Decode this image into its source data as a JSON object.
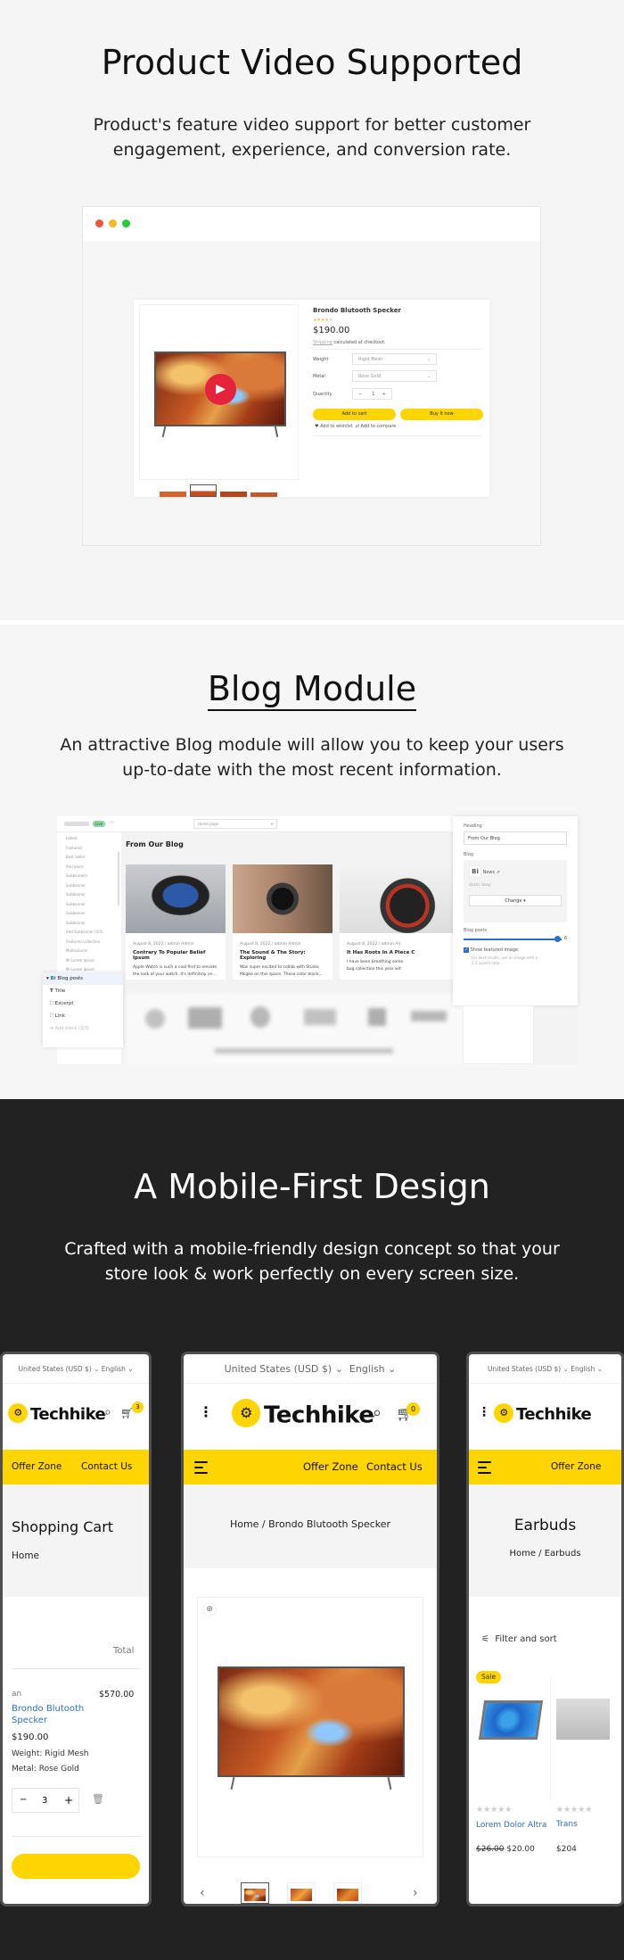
{
  "sections": {
    "video": {
      "title": "Product Video Supported",
      "subtitle_lines": [
        "Product's feature video support for better customer",
        "engagement, experience, and conversion rate."
      ],
      "product": {
        "name": "Brondo Blutooth Specker",
        "rating": 4,
        "price": "$190.00",
        "shipping_link": "Shipping",
        "shipping_text": "calculated at checkout.",
        "weight_label": "Weight",
        "weight_value": "Rigid Mesh",
        "metal_label": "Metal",
        "metal_value": "Rose Gold",
        "quantity_label": "Quantity",
        "quantity_value": "1",
        "minus": "−",
        "plus": "+",
        "add_to_cart": "Add to cart",
        "buy_now": "Buy it now",
        "wishlist": "Add to wishlist",
        "compare": "Add to compare"
      },
      "window_dots": [
        "#f0553d",
        "#f5b921",
        "#27c93f"
      ]
    },
    "blog": {
      "title": "Blog Module",
      "subtitle_lines": [
        "An attractive Blog module will allow you to keep your users",
        "up-to-date with the most recent information."
      ],
      "topbar": {
        "status": "Live",
        "page_select": "Home page"
      },
      "main_heading": "From Our Blog",
      "posts": [
        {
          "meta": "August 8, 2022 / admin Admin",
          "title": "Contrary To Popular Belief Ipsum",
          "excerpt_1": "Apple Watch is such a cool find to elevate",
          "excerpt_2": "the look of your watch. It's definitely on..."
        },
        {
          "meta": "August 8, 2022 / admin Admin",
          "title": "The Sound & The Story: Exploring",
          "excerpt_1": "Was super excited to collab with Studio",
          "excerpt_2": "Mcgee on this space. These color block..."
        },
        {
          "meta": "August 8, 2022 / admin Ad",
          "title": "It Has Roots In A Piece C",
          "excerpt_1": "I have been breathing some",
          "excerpt_2": "bag collection this year wit"
        }
      ],
      "sidebar_items": [
        "Latest",
        "Featured",
        "Best Seller",
        "Add block",
        "Subbanners",
        "Subbanner",
        "Subbanner",
        "Subbanner",
        "Subbanner",
        "Subbanner",
        "Add Subbanner (5/5)",
        "Featured collection",
        "Multicolumn",
        "Mi Lorem Ipsum",
        "Mi Lorem Ipsum"
      ],
      "sidebar_bottom": "Logo",
      "block_panel": {
        "header": "Blog posts",
        "items": [
          "Title",
          "Excerpt",
          "Link"
        ],
        "add_block": "Add block (3/3)"
      },
      "settings": {
        "heading_label": "Heading",
        "heading_value": "From Our Blog",
        "blog_label": "Blog",
        "blog_name": "News",
        "blog_sub": "Static blog",
        "change_button": "Change",
        "posts_label": "Blog posts",
        "posts_value": "6",
        "posts_fraction": 0.95,
        "featured_label": "Show featured image",
        "featured_checked": true,
        "featured_help_1": "For best results, use an image with a",
        "featured_help_2": "2:3 aspect ratio."
      }
    },
    "mobile": {
      "title": "A Mobile-First Design",
      "subtitle_lines": [
        "Crafted with a mobile-friendly design concept so that your",
        "store look & work perfectly on every screen size."
      ],
      "common": {
        "currency": "United States (USD $)",
        "language": "English",
        "logo": "Techhike",
        "nav_offer": "Offer Zone",
        "nav_contact": "Contact Us",
        "accent": "#ffd500"
      },
      "cart_phone": {
        "cart_count": "3",
        "title": "Shopping Cart",
        "breadcrumb": "Home",
        "total_label": "Total",
        "vendor": "an",
        "item_name_1": "Brondo Blutooth",
        "item_name_2": "Specker",
        "item_price": "$190.00",
        "line_total": "$570.00",
        "weight": "Weight: Rigid Mesh",
        "metal": "Metal: Rose Gold",
        "qty": "3",
        "plus": "+"
      },
      "product_phone": {
        "cart_count": "0",
        "breadcrumb_home": "Home /",
        "breadcrumb_current": "Brondo Blutooth Specker"
      },
      "collection_phone": {
        "title": "Earbuds",
        "breadcrumb_home": "Home /",
        "breadcrumb_current": "Earbuds",
        "filter": "Filter and sort",
        "sale_badge": "Sale",
        "products": [
          {
            "name": "Lorem Dolor Altra",
            "old_price": "$26.00",
            "price": "$20.00"
          },
          {
            "name": "Trans",
            "price": "$204"
          }
        ]
      }
    }
  }
}
